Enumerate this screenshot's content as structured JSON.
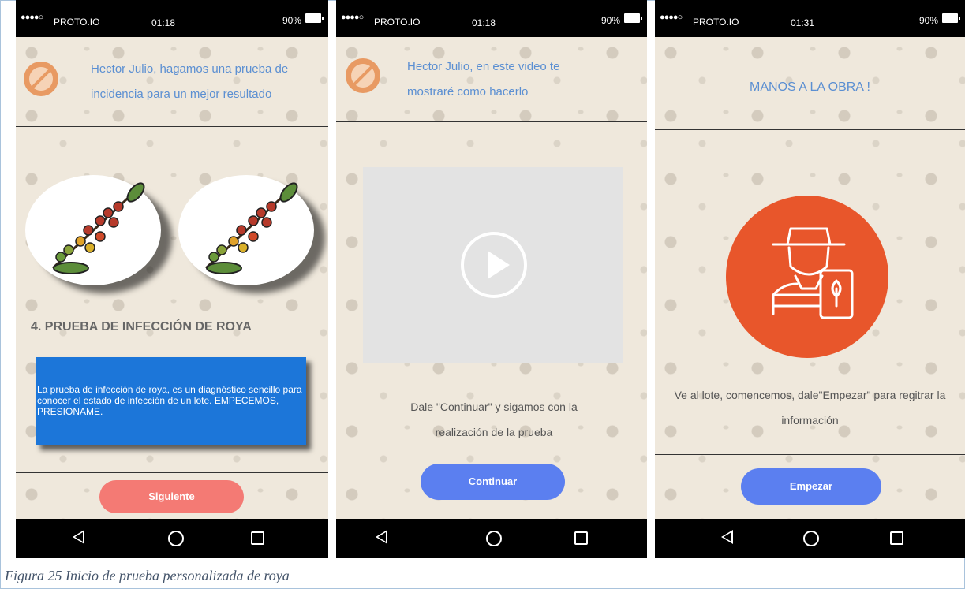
{
  "status_bar": {
    "dots": "●●●●○",
    "carrier": "PROTO.IO",
    "battery": "90%"
  },
  "screen1": {
    "time": "01:18",
    "header": "Hector Julio, hagamos una prueba de incidencia para un mejor resultado",
    "title": "4. PRUEBA DE INFECCIÓN DE ROYA",
    "description": "La prueba de infección de roya, es un diagnóstico sencillo para conocer el estado de infección de un lote. EMPECEMOS, PRESIONAME.",
    "button": "Siguiente"
  },
  "screen2": {
    "time": "01:18",
    "header": "Hector Julio, en este video te mostraré como hacerlo",
    "instruction": "Dale \"Continuar\" y sigamos con la realización de la prueba",
    "button": "Continuar"
  },
  "screen3": {
    "time": "01:31",
    "header": "MANOS A LA OBRA !",
    "instruction": "Ve al lote, comencemos, dale\"Empezar\" para regitrar la información",
    "button": "Empezar"
  },
  "caption": "Figura 25 Inicio de prueba personalizada de roya",
  "colors": {
    "coral_button": "#f47a74",
    "blue_button": "#5b7ff0",
    "info_box": "#1c76d9",
    "farmer_circle": "#e8562b",
    "header_text": "#5b8fd2"
  },
  "icons": [
    "back-icon",
    "home-icon",
    "recent-apps-icon",
    "play-icon",
    "coffee-branch-icon",
    "farmer-tablet-icon",
    "no-avatar-icon"
  ]
}
